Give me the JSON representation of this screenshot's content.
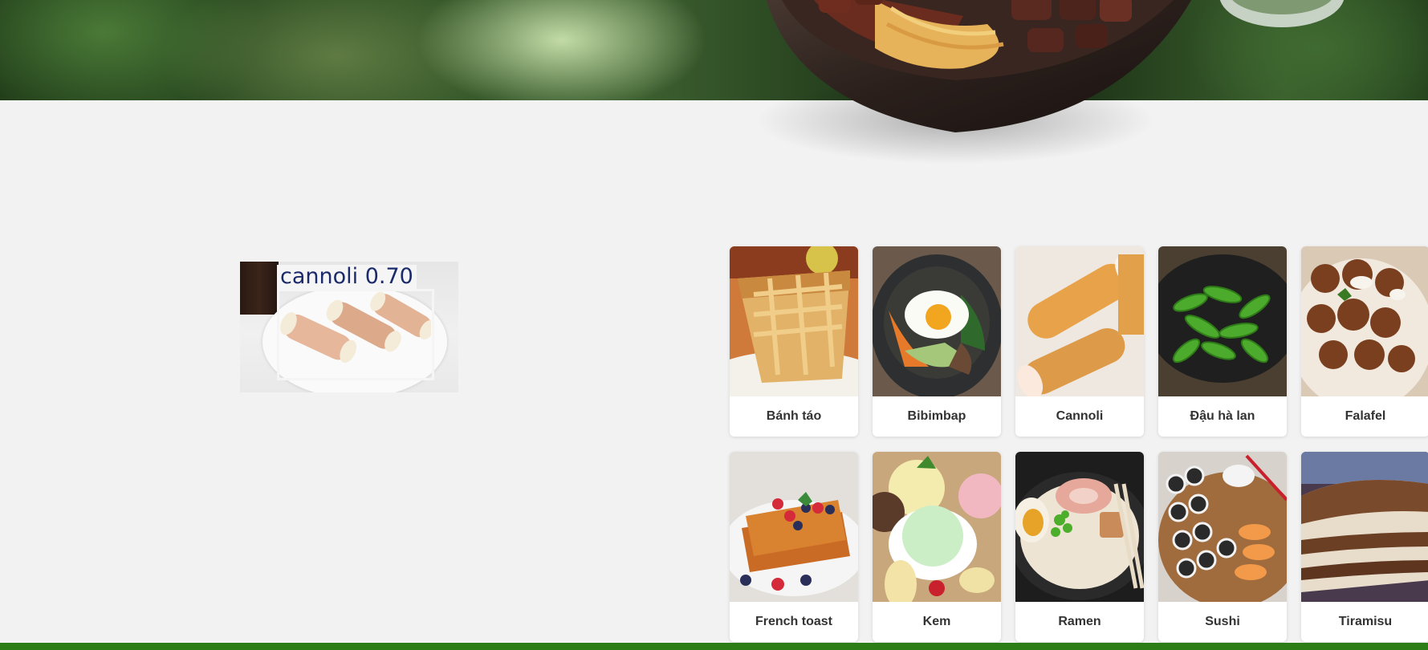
{
  "detection": {
    "label": "cannoli 0.70"
  },
  "foods": [
    {
      "name": "Bánh táo"
    },
    {
      "name": "Bibimbap"
    },
    {
      "name": "Cannoli"
    },
    {
      "name": "Đậu hà lan"
    },
    {
      "name": "Falafel"
    },
    {
      "name": "French toast"
    },
    {
      "name": "Kem"
    },
    {
      "name": "Ramen"
    },
    {
      "name": "Sushi"
    },
    {
      "name": "Tiramisu"
    }
  ],
  "colors": {
    "background": "#f2f2f2",
    "footer": "#2d7d16",
    "detection_text": "#1b2a6b",
    "card": "#ffffff"
  }
}
